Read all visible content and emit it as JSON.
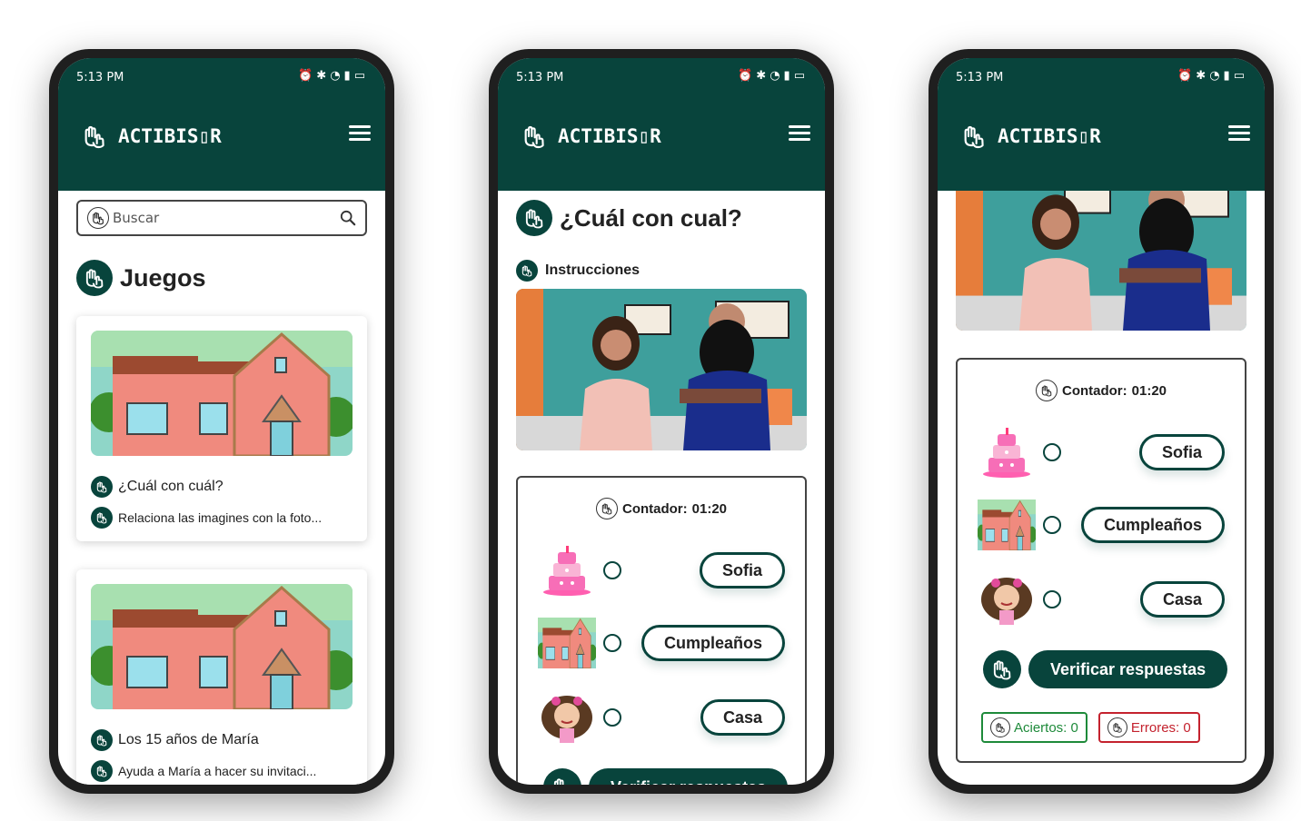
{
  "colors": {
    "brand": "#08443c",
    "correct": "#1e8a3a",
    "error": "#c4222e"
  },
  "status": {
    "time": "5:13 PM",
    "icons": [
      "alarm-icon",
      "bluetooth-icon",
      "wifi-icon",
      "signal-icon",
      "battery-icon"
    ]
  },
  "app": {
    "logo_text": "ACTIBIS▯R"
  },
  "screen1": {
    "search_placeholder": "Buscar",
    "section_title": "Juegos",
    "games": [
      {
        "title": "¿Cuál con cuál?",
        "description": "Relaciona las imagines con la foto..."
      },
      {
        "title": "Los 15 años de María",
        "description": "Ayuda a María a hacer su invitaci..."
      }
    ]
  },
  "screen2": {
    "title": "¿Cuál con cual?",
    "instructions_label": "Instrucciones",
    "counter_label": "Contador:",
    "counter_value": "01:20",
    "words": [
      "Sofia",
      "Cumpleaños",
      "Casa"
    ],
    "verify_label": "Verificar respuestas"
  },
  "screen3": {
    "counter_label": "Contador:",
    "counter_value": "01:20",
    "words": [
      "Sofia",
      "Cumpleaños",
      "Casa"
    ],
    "verify_label": "Verificar respuestas",
    "correct_label": "Aciertos: 0",
    "error_label": "Errores: 0"
  }
}
